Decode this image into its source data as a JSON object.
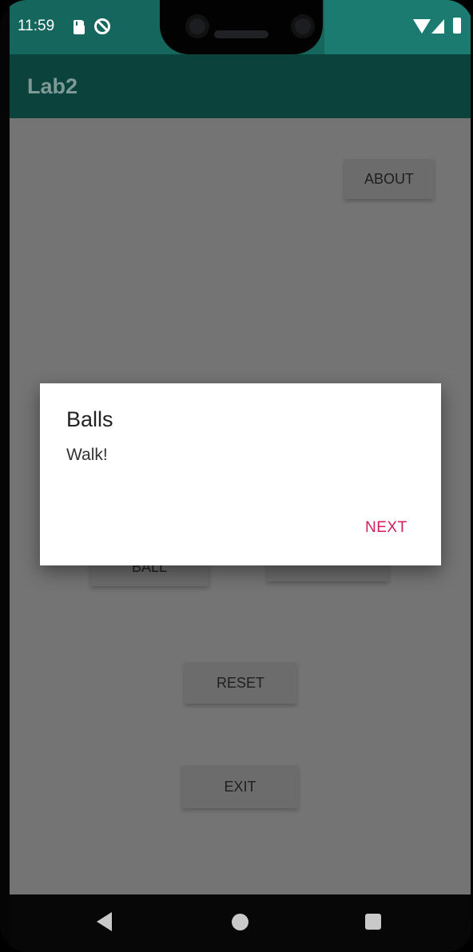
{
  "status_bar": {
    "time": "11:59",
    "icons": [
      "sd-card-icon",
      "no-disturb-icon",
      "wifi-icon",
      "signal-icon",
      "battery-icon"
    ]
  },
  "app": {
    "title": "Lab2",
    "colors": {
      "toolbar": "#0b433c",
      "status_bar": "#15675d",
      "content_overlay": "#747474",
      "accent": "#d81b60"
    }
  },
  "buttons": {
    "about": "ABOUT",
    "ball": "BALL",
    "reset": "RESET",
    "exit": "EXIT"
  },
  "dialog": {
    "title": "Balls",
    "message": "Walk!",
    "next": "NEXT"
  },
  "navigation": {
    "icons": [
      "back-icon",
      "home-icon",
      "recent-apps-icon"
    ]
  }
}
